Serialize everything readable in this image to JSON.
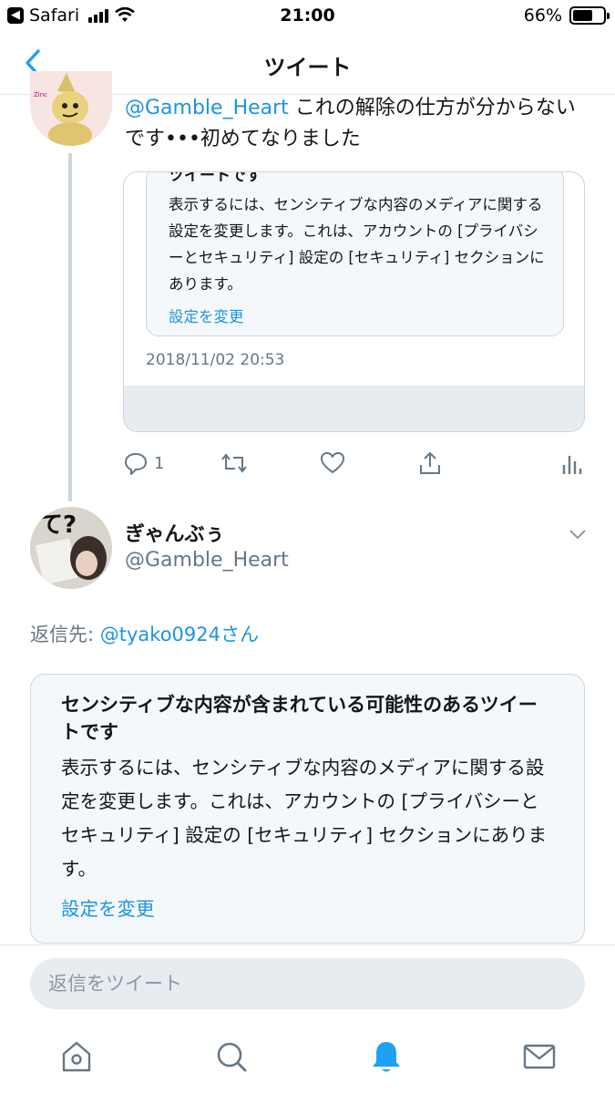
{
  "status_bar": {
    "back_app": "Safari",
    "time": "21:00",
    "battery": "66%",
    "battery_level": 0.66
  },
  "nav": {
    "title": "ツイート"
  },
  "parent_tweet": {
    "mention": "@Gamble_Heart",
    "text": " これの解除の仕方が分からないです•••初めてなりました",
    "quoted": {
      "cut_title": "ツイートです",
      "body": "表示するには、センシティブな内容のメディアに関する設定を変更します。これは、アカウントの [プライバシーとセキュリティ] 設定の [セキュリティ] セクションにあります。",
      "link": "設定を変更",
      "date": "2018/11/02 20:53"
    },
    "reply_count": "1"
  },
  "main_tweet": {
    "name": "ぎゃんぶぅ",
    "handle": "@Gamble_Heart",
    "reply_to_label": "返信先: ",
    "reply_to_mention": "@tyako0924さん",
    "sensitive": {
      "title": "センシティブな内容が含まれている可能性のあるツイートです",
      "body": "表示するには、センシティブな内容のメディアに関する設定を変更します。これは、アカウントの [プライバシーとセキュリティ] 設定の [セキュリティ] セクションにあります。",
      "link": "設定を変更"
    }
  },
  "reply_bar": {
    "placeholder": "返信をツイート"
  },
  "colors": {
    "accent": "#1b95e0",
    "muted": "#657786",
    "card_bg": "#f5f8fa",
    "border": "#ccd6dd"
  }
}
